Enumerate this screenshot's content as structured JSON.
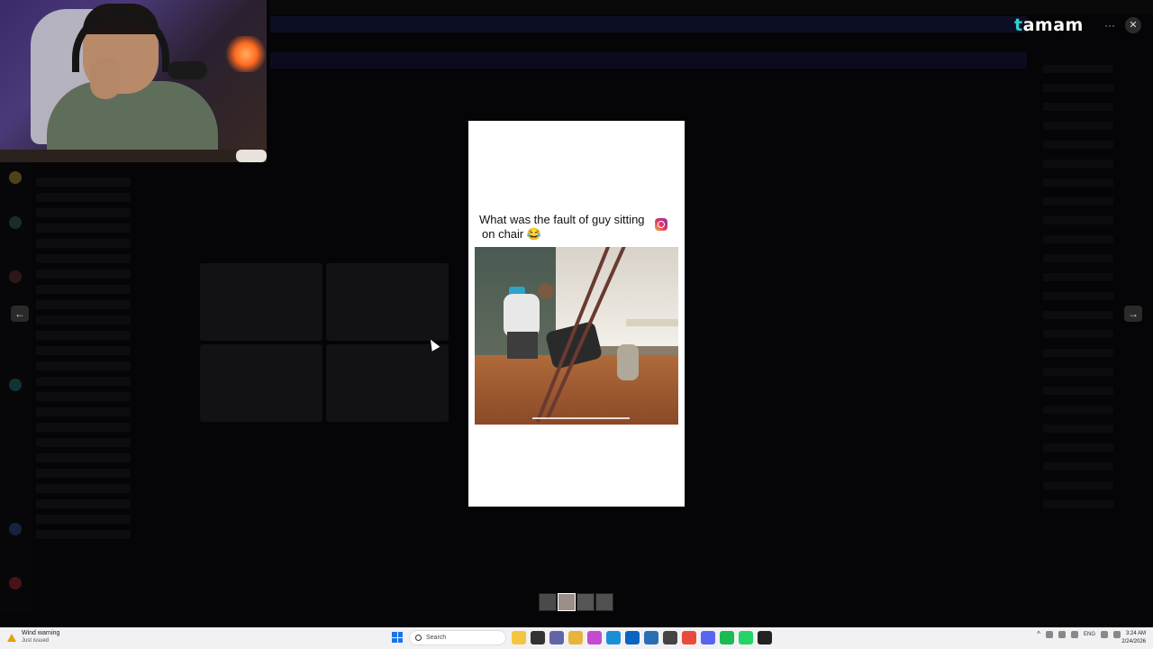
{
  "brand": {
    "name_prefix": "t",
    "name_rest": "amam"
  },
  "window_controls": {
    "more": "···",
    "close": "✕"
  },
  "navigation": {
    "prev": "←",
    "next": "→"
  },
  "post": {
    "caption_line1": "What was the fault of guy sitting",
    "caption_line2": "on chair 😂",
    "source_icon": "instagram-icon"
  },
  "thumbnails": {
    "count": 4,
    "active_index": 1
  },
  "taskbar": {
    "weather_title": "Wind warning",
    "weather_subtitle": "Just issued",
    "search_placeholder": "Search",
    "language": "ENG",
    "time": "3:24 AM",
    "date": "2/24/2026",
    "app_icons": [
      {
        "name": "file-explorer-icon",
        "color": "#f5c542"
      },
      {
        "name": "terminal-icon",
        "color": "#333333"
      },
      {
        "name": "teams-icon",
        "color": "#6264a7"
      },
      {
        "name": "folder-icon",
        "color": "#e8b339"
      },
      {
        "name": "photos-icon",
        "color": "#c34ad1"
      },
      {
        "name": "edge-icon",
        "color": "#1b8fd6"
      },
      {
        "name": "outlook-icon",
        "color": "#0a64c2"
      },
      {
        "name": "calculator-icon",
        "color": "#2a6fb5"
      },
      {
        "name": "app-icon",
        "color": "#444444"
      },
      {
        "name": "chrome-icon",
        "color": "#e84b3c"
      },
      {
        "name": "discord-icon",
        "color": "#5865f2"
      },
      {
        "name": "spotify-icon",
        "color": "#1db954"
      },
      {
        "name": "whatsapp-icon",
        "color": "#25d366"
      },
      {
        "name": "console-icon",
        "color": "#222222"
      }
    ]
  },
  "colors": {
    "accent": "#2fd3c8",
    "viewer_bg": "#ffffff",
    "backdrop": "#050507"
  }
}
